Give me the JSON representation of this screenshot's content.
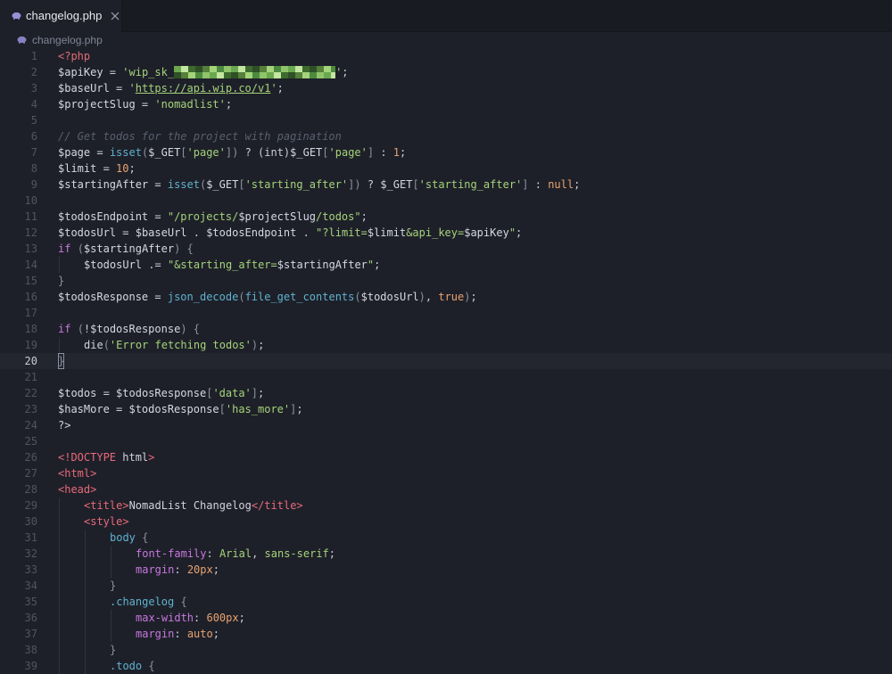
{
  "tab": {
    "label": "changelog.php",
    "icon": "php-elephant-icon",
    "close_icon": "close-icon"
  },
  "breadcrumb": {
    "label": "changelog.php"
  },
  "editor": {
    "current_line": 20,
    "lines": [
      {
        "n": "1",
        "segs": [
          [
            "tag",
            "<?php"
          ]
        ]
      },
      {
        "n": "2",
        "segs": [
          [
            "var",
            "$apiKey"
          ],
          [
            "op",
            " = "
          ],
          [
            "str",
            "'wip_sk_"
          ],
          [
            "redact",
            ""
          ],
          [
            "str",
            "'"
          ],
          [
            "op",
            ";"
          ]
        ]
      },
      {
        "n": "3",
        "segs": [
          [
            "var",
            "$baseUrl"
          ],
          [
            "op",
            " = "
          ],
          [
            "str",
            "'"
          ],
          [
            "link",
            "https://api.wip.co/v1"
          ],
          [
            "str",
            "'"
          ],
          [
            "op",
            ";"
          ]
        ]
      },
      {
        "n": "4",
        "segs": [
          [
            "var",
            "$projectSlug"
          ],
          [
            "op",
            " = "
          ],
          [
            "str",
            "'nomadlist'"
          ],
          [
            "op",
            ";"
          ]
        ]
      },
      {
        "n": "5",
        "segs": []
      },
      {
        "n": "6",
        "segs": [
          [
            "cmt",
            "// Get todos for the project with pagination"
          ]
        ]
      },
      {
        "n": "7",
        "segs": [
          [
            "var",
            "$page"
          ],
          [
            "op",
            " = "
          ],
          [
            "fn",
            "isset"
          ],
          [
            "brk",
            "("
          ],
          [
            "var",
            "$_GET"
          ],
          [
            "brk",
            "["
          ],
          [
            "str",
            "'page'"
          ],
          [
            "brk",
            "]"
          ],
          [
            "brk",
            ")"
          ],
          [
            "op",
            " ? (int)"
          ],
          [
            "var",
            "$_GET"
          ],
          [
            "brk",
            "["
          ],
          [
            "str",
            "'page'"
          ],
          [
            "brk",
            "]"
          ],
          [
            "op",
            " : "
          ],
          [
            "num",
            "1"
          ],
          [
            "op",
            ";"
          ]
        ]
      },
      {
        "n": "8",
        "segs": [
          [
            "var",
            "$limit"
          ],
          [
            "op",
            " = "
          ],
          [
            "num",
            "10"
          ],
          [
            "op",
            ";"
          ]
        ]
      },
      {
        "n": "9",
        "segs": [
          [
            "var",
            "$startingAfter"
          ],
          [
            "op",
            " = "
          ],
          [
            "fn",
            "isset"
          ],
          [
            "brk",
            "("
          ],
          [
            "var",
            "$_GET"
          ],
          [
            "brk",
            "["
          ],
          [
            "str",
            "'starting_after'"
          ],
          [
            "brk",
            "]"
          ],
          [
            "brk",
            ")"
          ],
          [
            "op",
            " ? "
          ],
          [
            "var",
            "$_GET"
          ],
          [
            "brk",
            "["
          ],
          [
            "str",
            "'starting_after'"
          ],
          [
            "brk",
            "]"
          ],
          [
            "op",
            " : "
          ],
          [
            "num",
            "null"
          ],
          [
            "op",
            ";"
          ]
        ]
      },
      {
        "n": "10",
        "segs": []
      },
      {
        "n": "11",
        "segs": [
          [
            "var",
            "$todosEndpoint"
          ],
          [
            "op",
            " = "
          ],
          [
            "str",
            "\"/projects/"
          ],
          [
            "var",
            "$projectSlug"
          ],
          [
            "str",
            "/todos\""
          ],
          [
            "op",
            ";"
          ]
        ]
      },
      {
        "n": "12",
        "segs": [
          [
            "var",
            "$todosUrl"
          ],
          [
            "op",
            " = "
          ],
          [
            "var",
            "$baseUrl"
          ],
          [
            "op",
            " . "
          ],
          [
            "var",
            "$todosEndpoint"
          ],
          [
            "op",
            " . "
          ],
          [
            "str",
            "\"?limit="
          ],
          [
            "var",
            "$limit"
          ],
          [
            "str",
            "&api_key="
          ],
          [
            "var",
            "$apiKey"
          ],
          [
            "str",
            "\""
          ],
          [
            "op",
            ";"
          ]
        ]
      },
      {
        "n": "13",
        "segs": [
          [
            "kw",
            "if"
          ],
          [
            "op",
            " "
          ],
          [
            "brk",
            "("
          ],
          [
            "var",
            "$startingAfter"
          ],
          [
            "brk",
            ")"
          ],
          [
            "op",
            " "
          ],
          [
            "brk",
            "{"
          ]
        ]
      },
      {
        "n": "14",
        "indent": 1,
        "segs": [
          [
            "var",
            "$todosUrl"
          ],
          [
            "op",
            " .= "
          ],
          [
            "str",
            "\"&starting_after="
          ],
          [
            "var",
            "$startingAfter"
          ],
          [
            "str",
            "\""
          ],
          [
            "op",
            ";"
          ]
        ]
      },
      {
        "n": "15",
        "segs": [
          [
            "brk",
            "}"
          ]
        ]
      },
      {
        "n": "16",
        "segs": [
          [
            "var",
            "$todosResponse"
          ],
          [
            "op",
            " = "
          ],
          [
            "fn",
            "json_decode"
          ],
          [
            "brk",
            "("
          ],
          [
            "fn",
            "file_get_contents"
          ],
          [
            "brk",
            "("
          ],
          [
            "var",
            "$todosUrl"
          ],
          [
            "brk",
            ")"
          ],
          [
            "op",
            ", "
          ],
          [
            "num",
            "true"
          ],
          [
            "brk",
            ")"
          ],
          [
            "op",
            ";"
          ]
        ]
      },
      {
        "n": "17",
        "segs": []
      },
      {
        "n": "18",
        "segs": [
          [
            "kw",
            "if"
          ],
          [
            "op",
            " "
          ],
          [
            "brk",
            "("
          ],
          [
            "op",
            "!"
          ],
          [
            "var",
            "$todosResponse"
          ],
          [
            "brk",
            ")"
          ],
          [
            "op",
            " "
          ],
          [
            "brk",
            "{"
          ]
        ]
      },
      {
        "n": "19",
        "indent": 1,
        "segs": [
          [
            "plain",
            "die"
          ],
          [
            "brk",
            "("
          ],
          [
            "str",
            "'Error fetching todos'"
          ],
          [
            "brk",
            ")"
          ],
          [
            "op",
            ";"
          ]
        ]
      },
      {
        "n": "20",
        "segs": [
          [
            "cursor",
            "}"
          ]
        ]
      },
      {
        "n": "21",
        "segs": []
      },
      {
        "n": "22",
        "segs": [
          [
            "var",
            "$todos"
          ],
          [
            "op",
            " = "
          ],
          [
            "var",
            "$todosResponse"
          ],
          [
            "brk",
            "["
          ],
          [
            "str",
            "'data'"
          ],
          [
            "brk",
            "]"
          ],
          [
            "op",
            ";"
          ]
        ]
      },
      {
        "n": "23",
        "segs": [
          [
            "var",
            "$hasMore"
          ],
          [
            "op",
            " = "
          ],
          [
            "var",
            "$todosResponse"
          ],
          [
            "brk",
            "["
          ],
          [
            "str",
            "'has_more'"
          ],
          [
            "brk",
            "]"
          ],
          [
            "op",
            ";"
          ]
        ]
      },
      {
        "n": "24",
        "segs": [
          [
            "plain",
            "?>"
          ]
        ]
      },
      {
        "n": "25",
        "segs": []
      },
      {
        "n": "26",
        "segs": [
          [
            "html",
            "<!DOCTYPE"
          ],
          [
            "plain",
            " html"
          ],
          [
            "html",
            ">"
          ]
        ]
      },
      {
        "n": "27",
        "segs": [
          [
            "html",
            "<html>"
          ]
        ]
      },
      {
        "n": "28",
        "segs": [
          [
            "html",
            "<head>"
          ]
        ]
      },
      {
        "n": "29",
        "indent": 1,
        "segs": [
          [
            "html",
            "<title>"
          ],
          [
            "plain",
            "NomadList Changelog"
          ],
          [
            "html",
            "</title>"
          ]
        ]
      },
      {
        "n": "30",
        "indent": 1,
        "segs": [
          [
            "html",
            "<style>"
          ]
        ]
      },
      {
        "n": "31",
        "indent": 2,
        "segs": [
          [
            "sel",
            "body"
          ],
          [
            "op",
            " "
          ],
          [
            "brk",
            "{"
          ]
        ]
      },
      {
        "n": "32",
        "indent": 3,
        "segs": [
          [
            "prop",
            "font-family"
          ],
          [
            "op",
            ": "
          ],
          [
            "cval",
            "Arial"
          ],
          [
            "op",
            ", "
          ],
          [
            "cval",
            "sans-serif"
          ],
          [
            "op",
            ";"
          ]
        ]
      },
      {
        "n": "33",
        "indent": 3,
        "segs": [
          [
            "prop",
            "margin"
          ],
          [
            "op",
            ": "
          ],
          [
            "num",
            "20px"
          ],
          [
            "op",
            ";"
          ]
        ]
      },
      {
        "n": "34",
        "indent": 2,
        "segs": [
          [
            "brk",
            "}"
          ]
        ]
      },
      {
        "n": "35",
        "indent": 2,
        "segs": [
          [
            "sel",
            ".changelog"
          ],
          [
            "op",
            " "
          ],
          [
            "brk",
            "{"
          ]
        ]
      },
      {
        "n": "36",
        "indent": 3,
        "segs": [
          [
            "prop",
            "max-width"
          ],
          [
            "op",
            ": "
          ],
          [
            "num",
            "600px"
          ],
          [
            "op",
            ";"
          ]
        ]
      },
      {
        "n": "37",
        "indent": 3,
        "segs": [
          [
            "prop",
            "margin"
          ],
          [
            "op",
            ": "
          ],
          [
            "num",
            "auto"
          ],
          [
            "op",
            ";"
          ]
        ]
      },
      {
        "n": "38",
        "indent": 2,
        "segs": [
          [
            "brk",
            "}"
          ]
        ]
      },
      {
        "n": "39",
        "indent": 2,
        "segs": [
          [
            "sel",
            ".todo"
          ],
          [
            "op",
            " "
          ],
          [
            "brk",
            "{"
          ]
        ]
      }
    ]
  }
}
